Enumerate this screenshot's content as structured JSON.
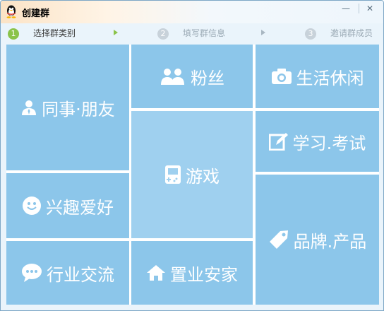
{
  "window": {
    "title": "创建群"
  },
  "steps": [
    {
      "num": "1",
      "label": "选择群类别"
    },
    {
      "num": "2",
      "label": "填写群信息"
    },
    {
      "num": "3",
      "label": "邀请群成员"
    }
  ],
  "controls": {
    "minimize": "—",
    "close": "✕"
  },
  "categories": {
    "colleague_friends": "同事·朋友",
    "fans": "粉丝",
    "leisure": "生活休闲",
    "games": "游戏",
    "study_exam": "学习.考试",
    "hobbies": "兴趣爱好",
    "brand_product": "品牌.产品",
    "industry": "行业交流",
    "home": "置业安家"
  },
  "colors": {
    "tile": "#8cc6ea",
    "accent": "#8bc34a"
  }
}
